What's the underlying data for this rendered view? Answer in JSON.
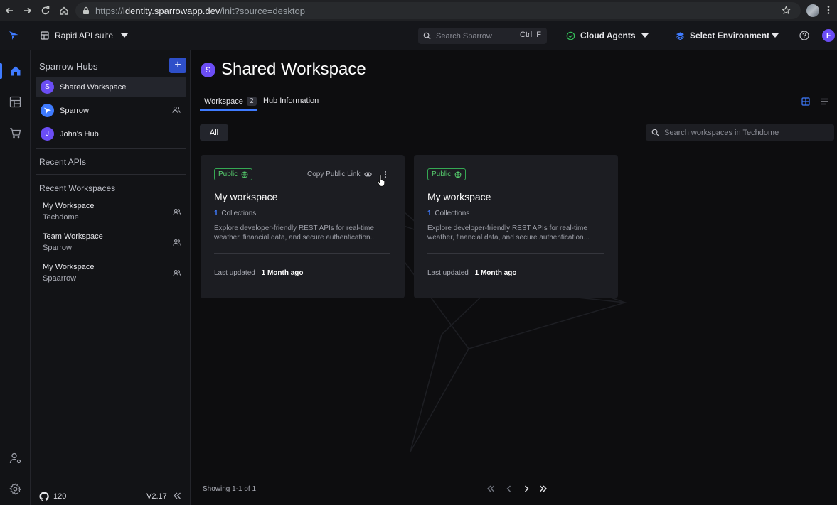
{
  "browser": {
    "url_scheme": "https://",
    "url_host": "identity.sparrowapp.dev",
    "url_path": "/init?source=desktop"
  },
  "header": {
    "suite_label": "Rapid API suite",
    "search_placeholder": "Search Sparrow",
    "search_shortcut": "Ctrl  F",
    "agents_label": "Cloud Agents",
    "env_label": "Select Environment",
    "avatar_initial": "F"
  },
  "sidebar": {
    "hubs_title": "Sparrow Hubs",
    "add_label": "+",
    "hubs": [
      {
        "initial": "S",
        "label": "Shared Workspace"
      },
      {
        "initial": "",
        "label": "Sparrow"
      },
      {
        "initial": "J",
        "label": "John's Hub"
      }
    ],
    "recent_apis_title": "Recent APIs",
    "recent_workspaces_title": "Recent Workspaces",
    "recent_workspaces": [
      {
        "name": "My Workspace",
        "hub": "Techdome"
      },
      {
        "name": "Team Workspace",
        "hub": "Sparrow"
      },
      {
        "name": "My Workspace",
        "hub": "Spaarrow"
      }
    ],
    "github_count": "120",
    "version": "V2.17"
  },
  "main": {
    "hub_initial": "S",
    "title": "Shared Workspace",
    "tabs": [
      {
        "label": "Workspace",
        "count": "2"
      },
      {
        "label": "Hub Information"
      }
    ],
    "filter_all": "All",
    "search_placeholder": "Search workspaces in Techdome",
    "cards": [
      {
        "badge": "Public",
        "copy_link": "Copy Public Link",
        "title": "My workspace",
        "collections_count": "1",
        "collections_label": "Collections",
        "description": "Explore developer-friendly REST APIs for real-time weather, financial data, and secure authentication...",
        "updated_label": "Last updated",
        "updated_value": "1 Month ago"
      },
      {
        "badge": "Public",
        "title": "My workspace",
        "collections_count": "1",
        "collections_label": "Collections",
        "description": "Explore developer-friendly REST APIs for real-time weather, financial data, and secure authentication...",
        "updated_label": "Last updated",
        "updated_value": "1 Month ago"
      }
    ],
    "showing": "Showing 1-1 of 1"
  },
  "colors": {
    "accent": "#3f7bff",
    "avatar": "#6b4df5",
    "public_green": "#57d16f"
  }
}
